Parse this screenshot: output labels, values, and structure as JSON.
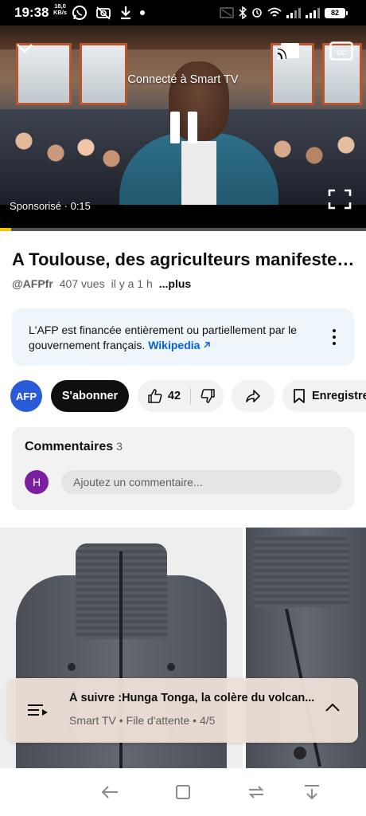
{
  "status_bar": {
    "time": "19:38",
    "speed_value": "18,0",
    "speed_unit": "KB/s",
    "battery": "82",
    "network": "4G"
  },
  "video": {
    "caption": "Connecté à Smart TV",
    "sponsor": "Sponsorisé · 0:15",
    "progress_percent": 3,
    "progress_color": "#f5c400"
  },
  "info": {
    "title": "A Toulouse, des agriculteurs manifesten…",
    "channel_handle": "@AFPfr",
    "views": "407 vues",
    "age": "il y a 1 h",
    "more_label": "...plus"
  },
  "notice": {
    "text": "L'AFP est financée entièrement ou partiellement par le gouvernement français. ",
    "link_label": "Wikipedia"
  },
  "actions": {
    "channel_avatar": "AFP",
    "subscribe_label": "S'abonner",
    "like_count": "42",
    "save_label": "Enregistrer"
  },
  "comments": {
    "heading": "Commentaires",
    "count": "3",
    "user_initial": "H",
    "placeholder": "Ajoutez un commentaire..."
  },
  "up_next": {
    "title": "À suivre :Hunga Tonga, la colère du volcan...",
    "subtitle": "Smart TV • File d'attente • 4/5"
  },
  "colors": {
    "accent_link": "#065fd4",
    "subscribe_bg": "#0f0f0f",
    "afp_blue": "#2a5bd7",
    "user_avatar": "#7b1fa2"
  }
}
